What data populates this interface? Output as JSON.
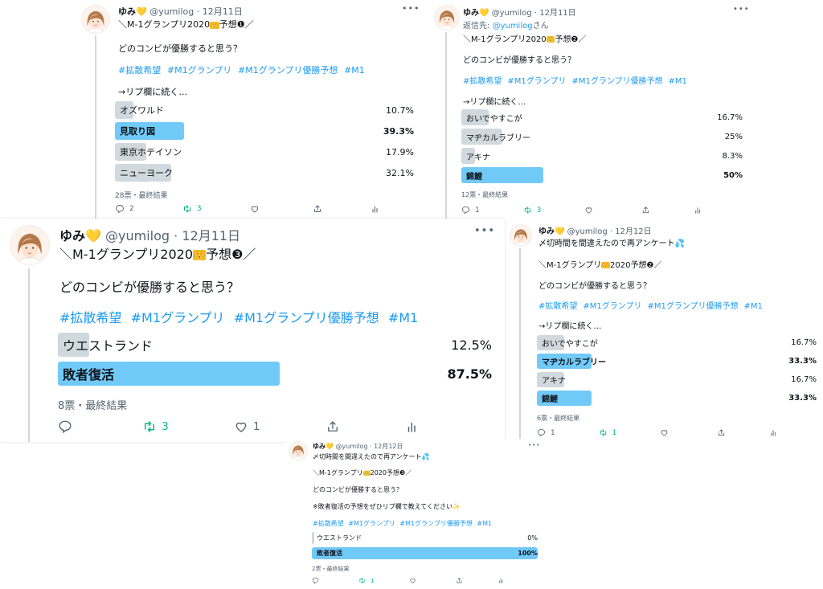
{
  "tweets": [
    {
      "name": "ゆみ",
      "heart": "💛",
      "handle": "@yumilog",
      "date": "· 12月11日",
      "reply_prefix": "",
      "reply_handle": "",
      "reply_suffix": "",
      "line1": "＼M-1グランプリ2020",
      "crown": "👑",
      "line1b": "予想❶／",
      "note": "",
      "question": "どのコンビが優勝すると思う？",
      "hashtags": [
        "#拡散希望",
        "#M1グランプリ",
        "#M1グランプリ優勝予想",
        "#M1"
      ],
      "cont": "→リプ欄に続く…",
      "options": [
        {
          "label": "オズワルド",
          "pct": "10.7%",
          "share": 0.107,
          "win": false
        },
        {
          "label": "見取り図",
          "pct": "39.3%",
          "share": 0.393,
          "win": true
        },
        {
          "label": "東京ホテイソン",
          "pct": "17.9%",
          "share": 0.179,
          "win": false
        },
        {
          "label": "ニューヨーク",
          "pct": "32.1%",
          "share": 0.321,
          "win": false
        }
      ],
      "meta": "28票・最終結果",
      "replies": "2",
      "retweets": "3",
      "likes": ""
    },
    {
      "name": "ゆみ",
      "heart": "💛",
      "handle": "@yumilog",
      "date": "· 12月11日",
      "reply_prefix": "返信先: ",
      "reply_handle": "@yumilog",
      "reply_suffix": "さん",
      "line1": "＼M-1グランプリ2020",
      "crown": "👑",
      "line1b": "予想❷／",
      "note": "",
      "question": "どのコンビが優勝すると思う？",
      "hashtags": [
        "#拡散希望",
        "#M1グランプリ",
        "#M1グランプリ優勝予想",
        "#M1"
      ],
      "cont": "→リプ欄に続く…",
      "options": [
        {
          "label": "おいでやすこが",
          "pct": "16.7%",
          "share": 0.167,
          "win": false
        },
        {
          "label": "マヂカルラブリー",
          "pct": "25%",
          "share": 0.25,
          "win": false
        },
        {
          "label": "アキナ",
          "pct": "8.3%",
          "share": 0.083,
          "win": false
        },
        {
          "label": "錦鯉",
          "pct": "50%",
          "share": 0.5,
          "win": true
        }
      ],
      "meta": "12票・最終結果",
      "replies": "1",
      "retweets": "3",
      "likes": ""
    },
    {
      "name": "ゆみ",
      "heart": "💛",
      "handle": "@yumilog",
      "date": "· 12月11日",
      "reply_prefix": "",
      "reply_handle": "",
      "reply_suffix": "",
      "line1": "＼M-1グランプリ2020",
      "crown": "👑",
      "line1b": "予想❸／",
      "note": "",
      "question": "どのコンビが優勝すると思う？",
      "hashtags": [
        "#拡散希望",
        "#M1グランプリ",
        "#M1グランプリ優勝予想",
        "#M1"
      ],
      "cont": "",
      "options": [
        {
          "label": "ウエストランド",
          "pct": "12.5%",
          "share": 0.125,
          "win": false
        },
        {
          "label": "敗者復活",
          "pct": "87.5%",
          "share": 0.875,
          "win": true
        }
      ],
      "meta": "8票・最終結果",
      "replies": "",
      "retweets": "3",
      "likes": "1"
    },
    {
      "name": "ゆみ",
      "heart": "💛",
      "handle": "@yumilog",
      "date": "· 12月12日",
      "reply_prefix": "",
      "reply_handle": "",
      "reply_suffix": "",
      "pre": "〆切時間を間違えたので再アンケート💦",
      "line1": "＼M-1グランプリ",
      "crown": "👑",
      "line1b": "2020予想❷／",
      "note": "",
      "question": "どのコンビが優勝すると思う？",
      "hashtags": [
        "#拡散希望",
        "#M1グランプリ",
        "#M1グランプリ優勝予想",
        "#M1"
      ],
      "cont": "→リプ欄に続く…",
      "options": [
        {
          "label": "おいでやすこが",
          "pct": "16.7%",
          "share": 0.167,
          "win": false
        },
        {
          "label": "マヂカルラブリー",
          "pct": "33.3%",
          "share": 0.333,
          "win": true
        },
        {
          "label": "アキナ",
          "pct": "16.7%",
          "share": 0.167,
          "win": false
        },
        {
          "label": "錦鯉",
          "pct": "33.3%",
          "share": 0.333,
          "win": true
        }
      ],
      "meta": "6票・最終結果",
      "replies": "1",
      "retweets": "1",
      "likes": ""
    },
    {
      "name": "ゆみ",
      "heart": "💛",
      "handle": "@yumilog",
      "date": "· 12月12日",
      "reply_prefix": "",
      "reply_handle": "",
      "reply_suffix": "",
      "pre": "〆切時間を間違えたので再アンケート💦",
      "line1": "＼M-1グランプリ",
      "crown": "👑",
      "line1b": "2020予想❸／",
      "note": "※敗者復活の予想をぜひリプ欄で教えてください✨",
      "question": "どのコンビが優勝すると思う？",
      "hashtags": [
        "#拡散希望",
        "#M1グランプリ",
        "#M1グランプリ優勝予想",
        "#M1"
      ],
      "cont": "",
      "options": [
        {
          "label": "ウエストランド",
          "pct": "0%",
          "share": 0,
          "win": false
        },
        {
          "label": "敗者復活",
          "pct": "100%",
          "share": 1.0,
          "win": true
        }
      ],
      "meta": "2票・最終結果",
      "replies": "",
      "retweets": "1",
      "likes": ""
    }
  ]
}
